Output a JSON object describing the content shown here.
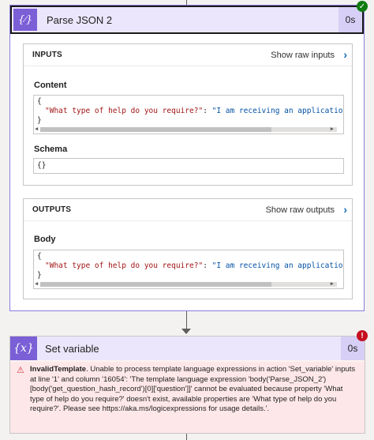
{
  "parse_json": {
    "title": "Parse JSON 2",
    "duration": "0s",
    "status_icon": "check-icon",
    "action_icon": "braces-icon",
    "inputs": {
      "label": "INPUTS",
      "show_raw_label": "Show raw inputs",
      "content_label": "Content",
      "content_open": "{",
      "content_line_key": "\"What type of help do you require?\"",
      "content_line_sep": ": ",
      "content_line_val": "\"I am receiving an application e",
      "content_close": "}",
      "schema_label": "Schema",
      "schema_value": "{}"
    },
    "outputs": {
      "label": "OUTPUTS",
      "show_raw_label": "Show raw outputs",
      "body_label": "Body",
      "body_open": "{",
      "body_line_key": "\"What type of help do you require?\"",
      "body_line_sep": ": ",
      "body_line_val": "\"I am receiving an application e",
      "body_close": "}"
    }
  },
  "set_variable": {
    "title": "Set variable",
    "duration": "0s",
    "status_icon": "error-icon",
    "action_icon": "variable-icon",
    "error_code": "InvalidTemplate",
    "error_message": ". Unable to process template language expressions in action 'Set_variable' inputs at line '1' and column '16054': 'The template language expression 'body('Parse_JSON_2')[body('get_question_hash_record')[0]['question']]' cannot be evaluated because property 'What type of help do you require?' doesn't exist, available properties are 'What type of help do you require?'. Please see https://aka.ms/logicexpressions for usage details.'."
  },
  "colors": {
    "accent": "#7a5fd6",
    "header_bg": "#ebe6fb",
    "success": "#107c10",
    "error": "#c50f1f",
    "link": "#0f6cbd"
  }
}
